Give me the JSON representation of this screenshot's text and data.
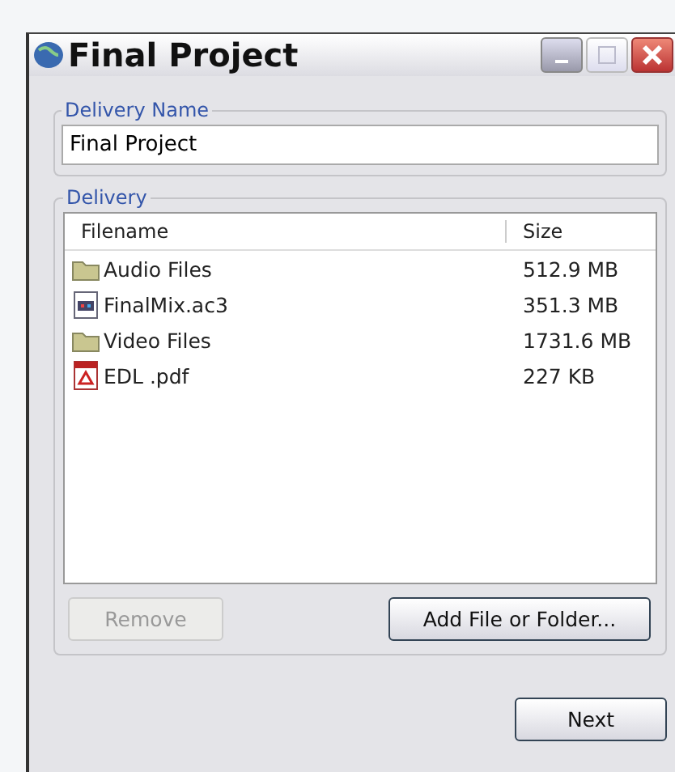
{
  "window": {
    "title": "Final Project"
  },
  "delivery_name": {
    "label": "Delivery Name",
    "value": "Final Project"
  },
  "delivery": {
    "label": "Delivery",
    "columns": [
      "Filename",
      "Size"
    ],
    "rows": [
      {
        "kind": "folder",
        "name": "Audio Files",
        "size": "512.9 MB"
      },
      {
        "kind": "media",
        "name": "FinalMix.ac3",
        "size": "351.3 MB"
      },
      {
        "kind": "folder",
        "name": "Video Files",
        "size": "1731.6 MB"
      },
      {
        "kind": "pdf",
        "name": "EDL .pdf",
        "size": "227 KB"
      }
    ],
    "buttons": [
      {
        "label": "Remove",
        "disabled": true
      },
      {
        "label": "Add File or Folder...",
        "disabled": false
      }
    ]
  },
  "footer_buttons": [
    {
      "label": "Next",
      "disabled": false
    }
  ]
}
